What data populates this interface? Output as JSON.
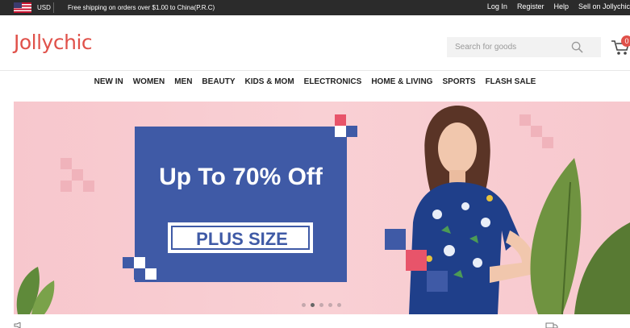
{
  "topbar": {
    "currency": "USD",
    "promo": "Free shipping on orders over $1.00 to China(P.R.C)",
    "links": [
      "Log In",
      "Register",
      "Help",
      "Sell on Jollychic"
    ]
  },
  "header": {
    "logo": "Jollychic",
    "search_placeholder": "Search for goods",
    "cart_count": "0"
  },
  "nav": {
    "items": [
      "NEW IN",
      "WOMEN",
      "MEN",
      "BEAUTY",
      "KIDS & MOM",
      "ELECTRONICS",
      "HOME & LIVING",
      "SPORTS",
      "FLASH SALE"
    ]
  },
  "banner": {
    "headline": "Up To 70% Off",
    "tag": "PLUS SIZE",
    "slide_count": 5,
    "active_slide": 2
  },
  "colors": {
    "brand": "#e0514a",
    "topbar_bg": "#2b2b2b",
    "banner_blue": "#3f5aa6",
    "banner_pink": "#f7c7cd"
  }
}
